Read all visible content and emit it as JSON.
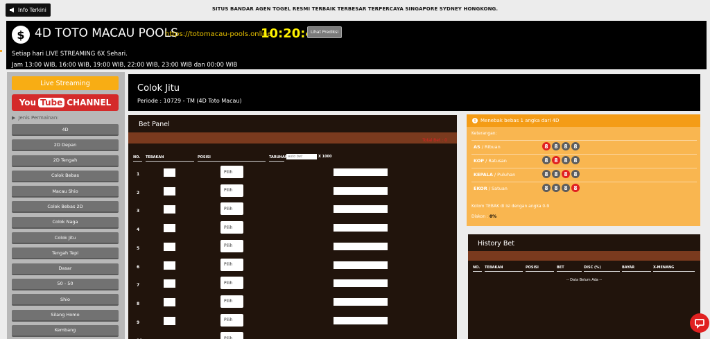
{
  "ticker": {
    "info_label": "Info Terkini",
    "text": "SITUS BANDAR AGEN TOGEL RESMI TERBAIK TERBESAR TERPERCAYA SINGAPORE SYDNEY HONGKONG."
  },
  "header": {
    "coin_symbol": "$",
    "title": "4D TOTO MACAU POOLS",
    "url": "https://totomacau-pools.online",
    "clock": "10:20:45",
    "predict_label": "Lihat Prediksi",
    "stream_line1": "Setiap hari LIVE STREAMING 6X Sehari.",
    "stream_line2": "Jam 13:00 WIB, 16:00 WIB, 19:00 WIB, 22:00 WIB, 23:00 WIB dan 00:00 WIB"
  },
  "sidebar": {
    "live_label": "Live Streaming",
    "yt_you": "You",
    "yt_tube": "Tube",
    "yt_channel": "CHANNEL",
    "jenis_label": "Jenis Permainan:",
    "items": [
      "4D",
      "2D Depan",
      "2D Tengah",
      "Colok Bebas",
      "Macau Shio",
      "Colok Bebas 2D",
      "Colok Naga",
      "Colok Jitu",
      "Tengah Tepi",
      "Dasar",
      "50 - 50",
      "Shio",
      "Silang Homo",
      "Kembang"
    ]
  },
  "game": {
    "title": "Colok Jitu",
    "period": "Periode : 10729 - TM (4D Toto Macau)"
  },
  "bet_panel": {
    "title": "Bet Panel",
    "total_bet": "Total Bet : 0",
    "col_no": "NO.",
    "col_tebakan": "TEBAKAN",
    "col_posisi": "POSISI",
    "col_taruhan": "TARUHAN",
    "bet_placeholder": "auto bet",
    "x1000": "X 1000",
    "pilih": "Pilih",
    "rows": [
      "1",
      "2",
      "3",
      "4",
      "5",
      "6",
      "7",
      "8",
      "9",
      "10"
    ]
  },
  "info_panel": {
    "header": "Menebak bebas 1 angka dari 4D",
    "keterangan": "Keterangan:",
    "positions": [
      {
        "key": "AS",
        "label": " / Ribuan",
        "balls": [
          "8",
          "8",
          "8",
          "8"
        ],
        "red": 0
      },
      {
        "key": "KOP",
        "label": " / Ratusan",
        "balls": [
          "8",
          "8",
          "8",
          "8"
        ],
        "red": 1
      },
      {
        "key": "KEPALA",
        "label": " / Puluhan",
        "balls": [
          "8",
          "8",
          "8",
          "8"
        ],
        "red": 2
      },
      {
        "key": "EKOR",
        "label": " / Satuan",
        "balls": [
          "8",
          "8",
          "8",
          "8"
        ],
        "red": 3
      }
    ],
    "note": "Kolom TEBAK di isi dengan angka 0-9",
    "diskon_label": "Diskon : ",
    "diskon_value": "0%",
    "red_color": "#e02121",
    "grey_color": "#5d5d5d"
  },
  "history": {
    "title": "History Bet",
    "cols": [
      "NO.",
      "TEBAKAN",
      "POSISI",
      "BET",
      "DISC (%)",
      "BAYAR",
      "X-MENANG"
    ],
    "empty": "-- Data Belum Ada --"
  },
  "colors": {
    "accent_orange": "#f8ad14",
    "clock_yellow": "#fff200",
    "panel_brown": "#21140c"
  }
}
